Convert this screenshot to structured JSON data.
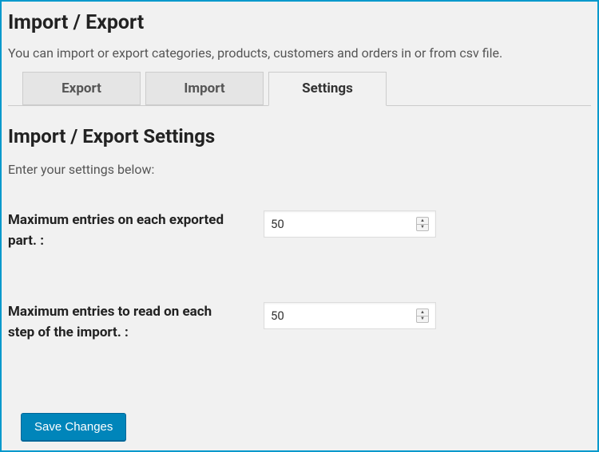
{
  "header": {
    "title": "Import / Export",
    "description": "You can import or export categories, products, customers and orders in or from csv file."
  },
  "tabs": {
    "export": "Export",
    "import": "Import",
    "settings": "Settings"
  },
  "section": {
    "title": "Import / Export Settings",
    "description": "Enter your settings below:"
  },
  "form": {
    "max_export": {
      "label": "Maximum entries on each exported part. :",
      "value": "50"
    },
    "max_import": {
      "label": "Maximum entries to read on each step of the import. :",
      "value": "50"
    }
  },
  "actions": {
    "save": "Save Changes"
  }
}
